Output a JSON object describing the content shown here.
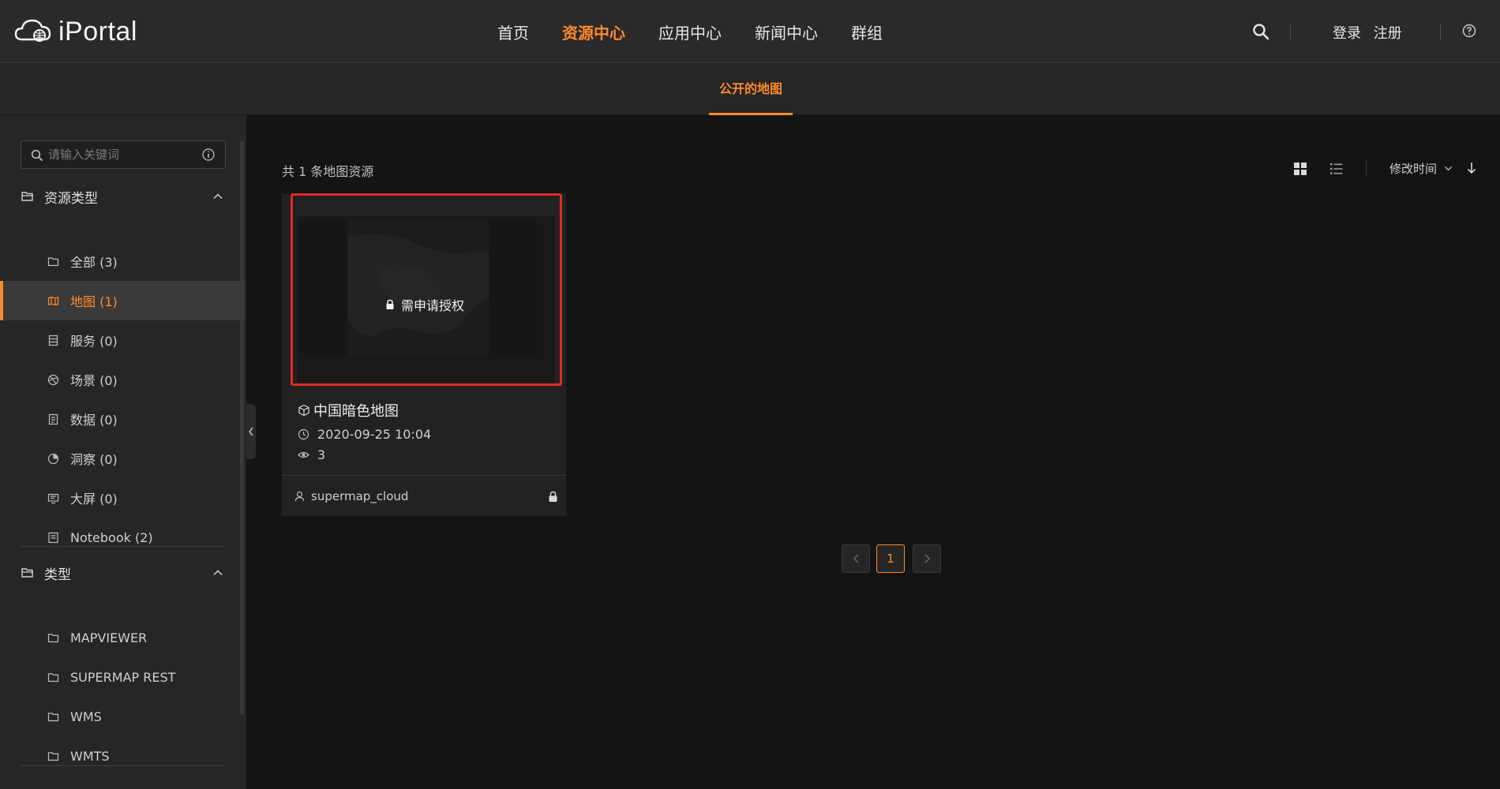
{
  "app": {
    "name": "iPortal",
    "logo_icon": "cloud-logo-icon"
  },
  "nav": {
    "items": [
      {
        "label": "首页",
        "active": false
      },
      {
        "label": "资源中心",
        "active": true
      },
      {
        "label": "应用中心",
        "active": false
      },
      {
        "label": "新闻中心",
        "active": false
      },
      {
        "label": "群组",
        "active": false
      }
    ],
    "login_label": "登录",
    "register_label": "注册",
    "search_icon": "search-icon",
    "help_icon": "help-icon"
  },
  "subnav": {
    "tab_label": "公开的地图"
  },
  "sidebar": {
    "search": {
      "placeholder": "请输入关键词",
      "value": ""
    },
    "group_resource_type": {
      "label": "资源类型",
      "items": [
        {
          "label": "全部 (3)",
          "icon": "folder-icon",
          "active": false
        },
        {
          "label": "地图 (1)",
          "icon": "map-icon",
          "active": true
        },
        {
          "label": "服务 (0)",
          "icon": "server-icon",
          "active": false
        },
        {
          "label": "场景 (0)",
          "icon": "scene-icon",
          "active": false
        },
        {
          "label": "数据 (0)",
          "icon": "data-icon",
          "active": false
        },
        {
          "label": "洞察 (0)",
          "icon": "insight-icon",
          "active": false
        },
        {
          "label": "大屏 (0)",
          "icon": "dashboard-icon",
          "active": false
        },
        {
          "label": "Notebook (2)",
          "icon": "notebook-icon",
          "active": false
        }
      ]
    },
    "group_type": {
      "label": "类型",
      "items": [
        {
          "label": "MAPVIEWER",
          "icon": "folder-icon"
        },
        {
          "label": "SUPERMAP REST",
          "icon": "folder-icon"
        },
        {
          "label": "WMS",
          "icon": "folder-icon"
        },
        {
          "label": "WMTS",
          "icon": "folder-icon"
        }
      ]
    }
  },
  "main": {
    "count_label": "共 1 条地图资源",
    "sort_label": "修改时间",
    "card": {
      "title": "中国暗色地图",
      "lock_label": "需申请授权",
      "modified": "2020-09-25 10:04",
      "views": "3",
      "owner": "supermap_cloud"
    },
    "pager": {
      "current": "1"
    }
  },
  "colors": {
    "accent": "#ff8a2b",
    "highlight": "#e12a24",
    "background": "#141414",
    "panel": "#262626"
  }
}
